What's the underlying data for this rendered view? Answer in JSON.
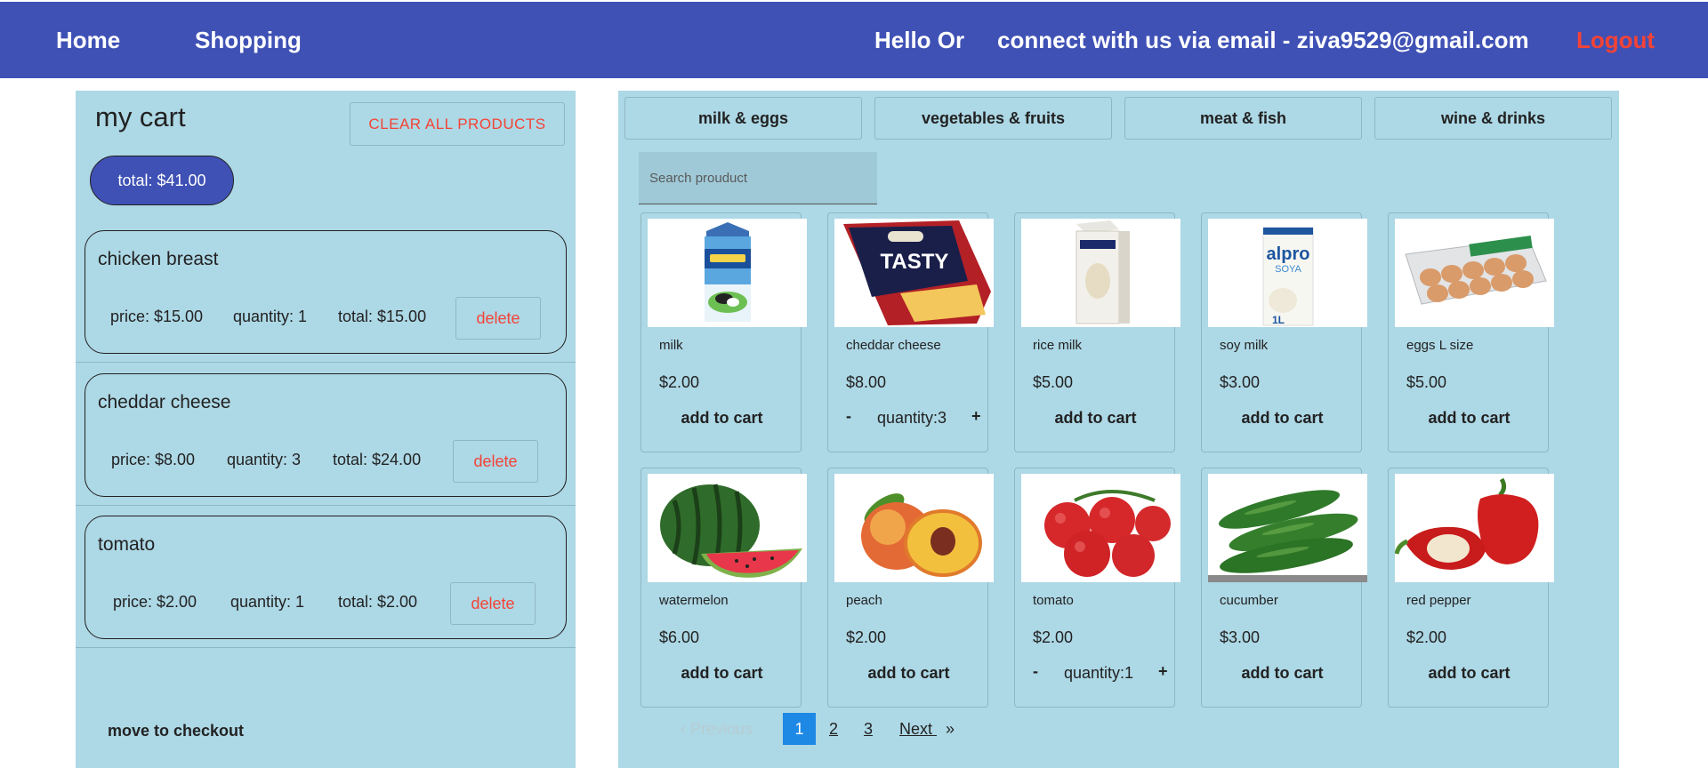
{
  "header": {
    "home": "Home",
    "shopping": "Shopping",
    "greeting": "Hello Or",
    "contact": "connect with us via email - ziva9529@gmail.com",
    "logout": "Logout"
  },
  "cart": {
    "title": "my cart",
    "clear_label": "CLEAR ALL PRODUCTS",
    "total": "total: $41.00",
    "items": [
      {
        "name": "chicken breast",
        "price": "price: $15.00",
        "quantity": "quantity: 1",
        "total": "total: $15.00",
        "delete": "delete"
      },
      {
        "name": "cheddar cheese",
        "price": "price: $8.00",
        "quantity": "quantity: 3",
        "total": "total: $24.00",
        "delete": "delete"
      },
      {
        "name": "tomato",
        "price": "price: $2.00",
        "quantity": "quantity: 1",
        "total": "total: $2.00",
        "delete": "delete"
      }
    ],
    "checkout": "move to checkout"
  },
  "shop": {
    "categories": [
      "milk & eggs",
      "vegetables & fruits",
      "meat & fish",
      "wine & drinks"
    ],
    "search_placeholder": "Search prouduct",
    "add_label": "add to cart",
    "minus": "-",
    "plus": "+",
    "products": [
      {
        "name": "milk",
        "price": "$2.00",
        "image": "milk-carton-image"
      },
      {
        "name": "cheddar cheese",
        "price": "$8.00",
        "image": "cheddar-cheese-pack-image",
        "in_cart_qty": "quantity:3"
      },
      {
        "name": "rice milk",
        "price": "$5.00",
        "image": "rice-milk-carton-image"
      },
      {
        "name": "soy milk",
        "price": "$3.00",
        "image": "soy-milk-carton-image"
      },
      {
        "name": "eggs L size",
        "price": "$5.00",
        "image": "egg-carton-image"
      },
      {
        "name": "watermelon",
        "price": "$6.00",
        "image": "watermelon-image"
      },
      {
        "name": "peach",
        "price": "$2.00",
        "image": "peach-image"
      },
      {
        "name": "tomato",
        "price": "$2.00",
        "image": "tomato-image",
        "in_cart_qty": "quantity:1"
      },
      {
        "name": "cucumber",
        "price": "$3.00",
        "image": "cucumber-image"
      },
      {
        "name": "red pepper",
        "price": "$2.00",
        "image": "red-pepper-image"
      }
    ],
    "pagination": {
      "previous": "‹ Previous",
      "pages": [
        "1",
        "2",
        "3"
      ],
      "current": "1",
      "next": "Next",
      "next_arrow": "»"
    }
  },
  "colors": {
    "header_bg": "#3f51b5",
    "panel_bg": "#add8e6",
    "accent_red": "#f44336",
    "page_active": "#1e88e5"
  }
}
